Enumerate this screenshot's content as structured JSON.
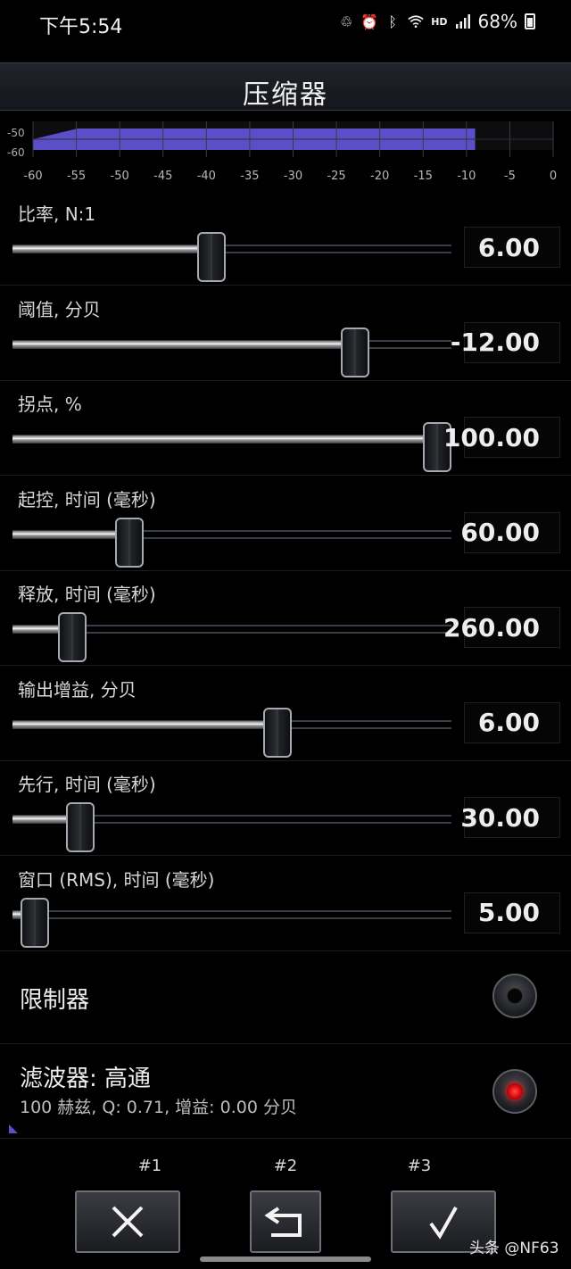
{
  "status_bar": {
    "time": "下午5:54",
    "hd": "HD",
    "battery": "68%",
    "icons": [
      "recycle-icon",
      "alarm-icon",
      "bluetooth-icon",
      "wifi-icon",
      "signal-icon",
      "battery-icon"
    ]
  },
  "header": {
    "title": "压缩器"
  },
  "chart_data": {
    "type": "area",
    "y_ticks": [
      "-50",
      "-60"
    ],
    "x_ticks": [
      "-60",
      "-55",
      "-50",
      "-45",
      "-40",
      "-35",
      "-30",
      "-25",
      "-20",
      "-15",
      "-10",
      "-5",
      "0"
    ],
    "xlim": [
      -60,
      0
    ],
    "fill_to": -9,
    "fill_color": "#5b4fc9",
    "grid": true
  },
  "sliders": [
    {
      "label": "比率, N:1",
      "value": "6.00",
      "level": 0.45
    },
    {
      "label": "阈值, 分贝",
      "value": "-12.00",
      "level": 0.8
    },
    {
      "label": "拐点, %",
      "value": "100.00",
      "level": 1.0
    },
    {
      "label": "起控, 时间 (毫秒)",
      "value": "60.00",
      "level": 0.25
    },
    {
      "label": "释放, 时间 (毫秒)",
      "value": "260.00",
      "level": 0.11
    },
    {
      "label": "输出增益, 分贝",
      "value": "6.00",
      "level": 0.61
    },
    {
      "label": "先行, 时间 (毫秒)",
      "value": "30.00",
      "level": 0.13
    },
    {
      "label": "窗口 (RMS), 时间 (毫秒)",
      "value": "5.00",
      "level": 0.02
    }
  ],
  "limiter": {
    "label": "限制器",
    "enabled": false
  },
  "filter": {
    "label": "滤波器: 高通",
    "detail": "100 赫兹, Q: 0.71, 增益: 0.00 分贝",
    "enabled": true
  },
  "presets": {
    "labels": [
      "#1",
      "#2",
      "#3"
    ],
    "buttons": [
      "close-icon",
      "undo-icon",
      "checkmark-icon"
    ]
  },
  "watermark": "头条 @NF63",
  "colors": {
    "accent": "#5b4fc9",
    "led_on": "#ff2020"
  }
}
